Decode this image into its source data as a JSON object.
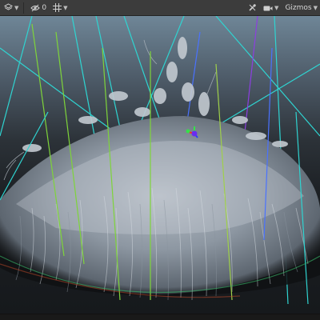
{
  "toolbar": {
    "visibility_count": "0",
    "gizmos_label": "Gizmos"
  },
  "colors": {
    "toolbar_bg": "#3c3c3c",
    "sky_top": "#6f8697",
    "horizon": "#2a2f33",
    "ground": "#16191c",
    "line_cyan": "#2fd4d1",
    "line_green": "#7ed43a",
    "line_blue": "#4a72ff",
    "line_purple": "#8c3fe0",
    "gizmo_red": "#ff2a2a",
    "gizmo_green": "#35e04a",
    "gizmo_blue": "#2d3cff"
  },
  "icons": {
    "layers": "layers-icon",
    "visibility": "eye-slash-icon",
    "grid": "grid-icon",
    "tools": "tools-icon",
    "camera": "camera-icon"
  }
}
